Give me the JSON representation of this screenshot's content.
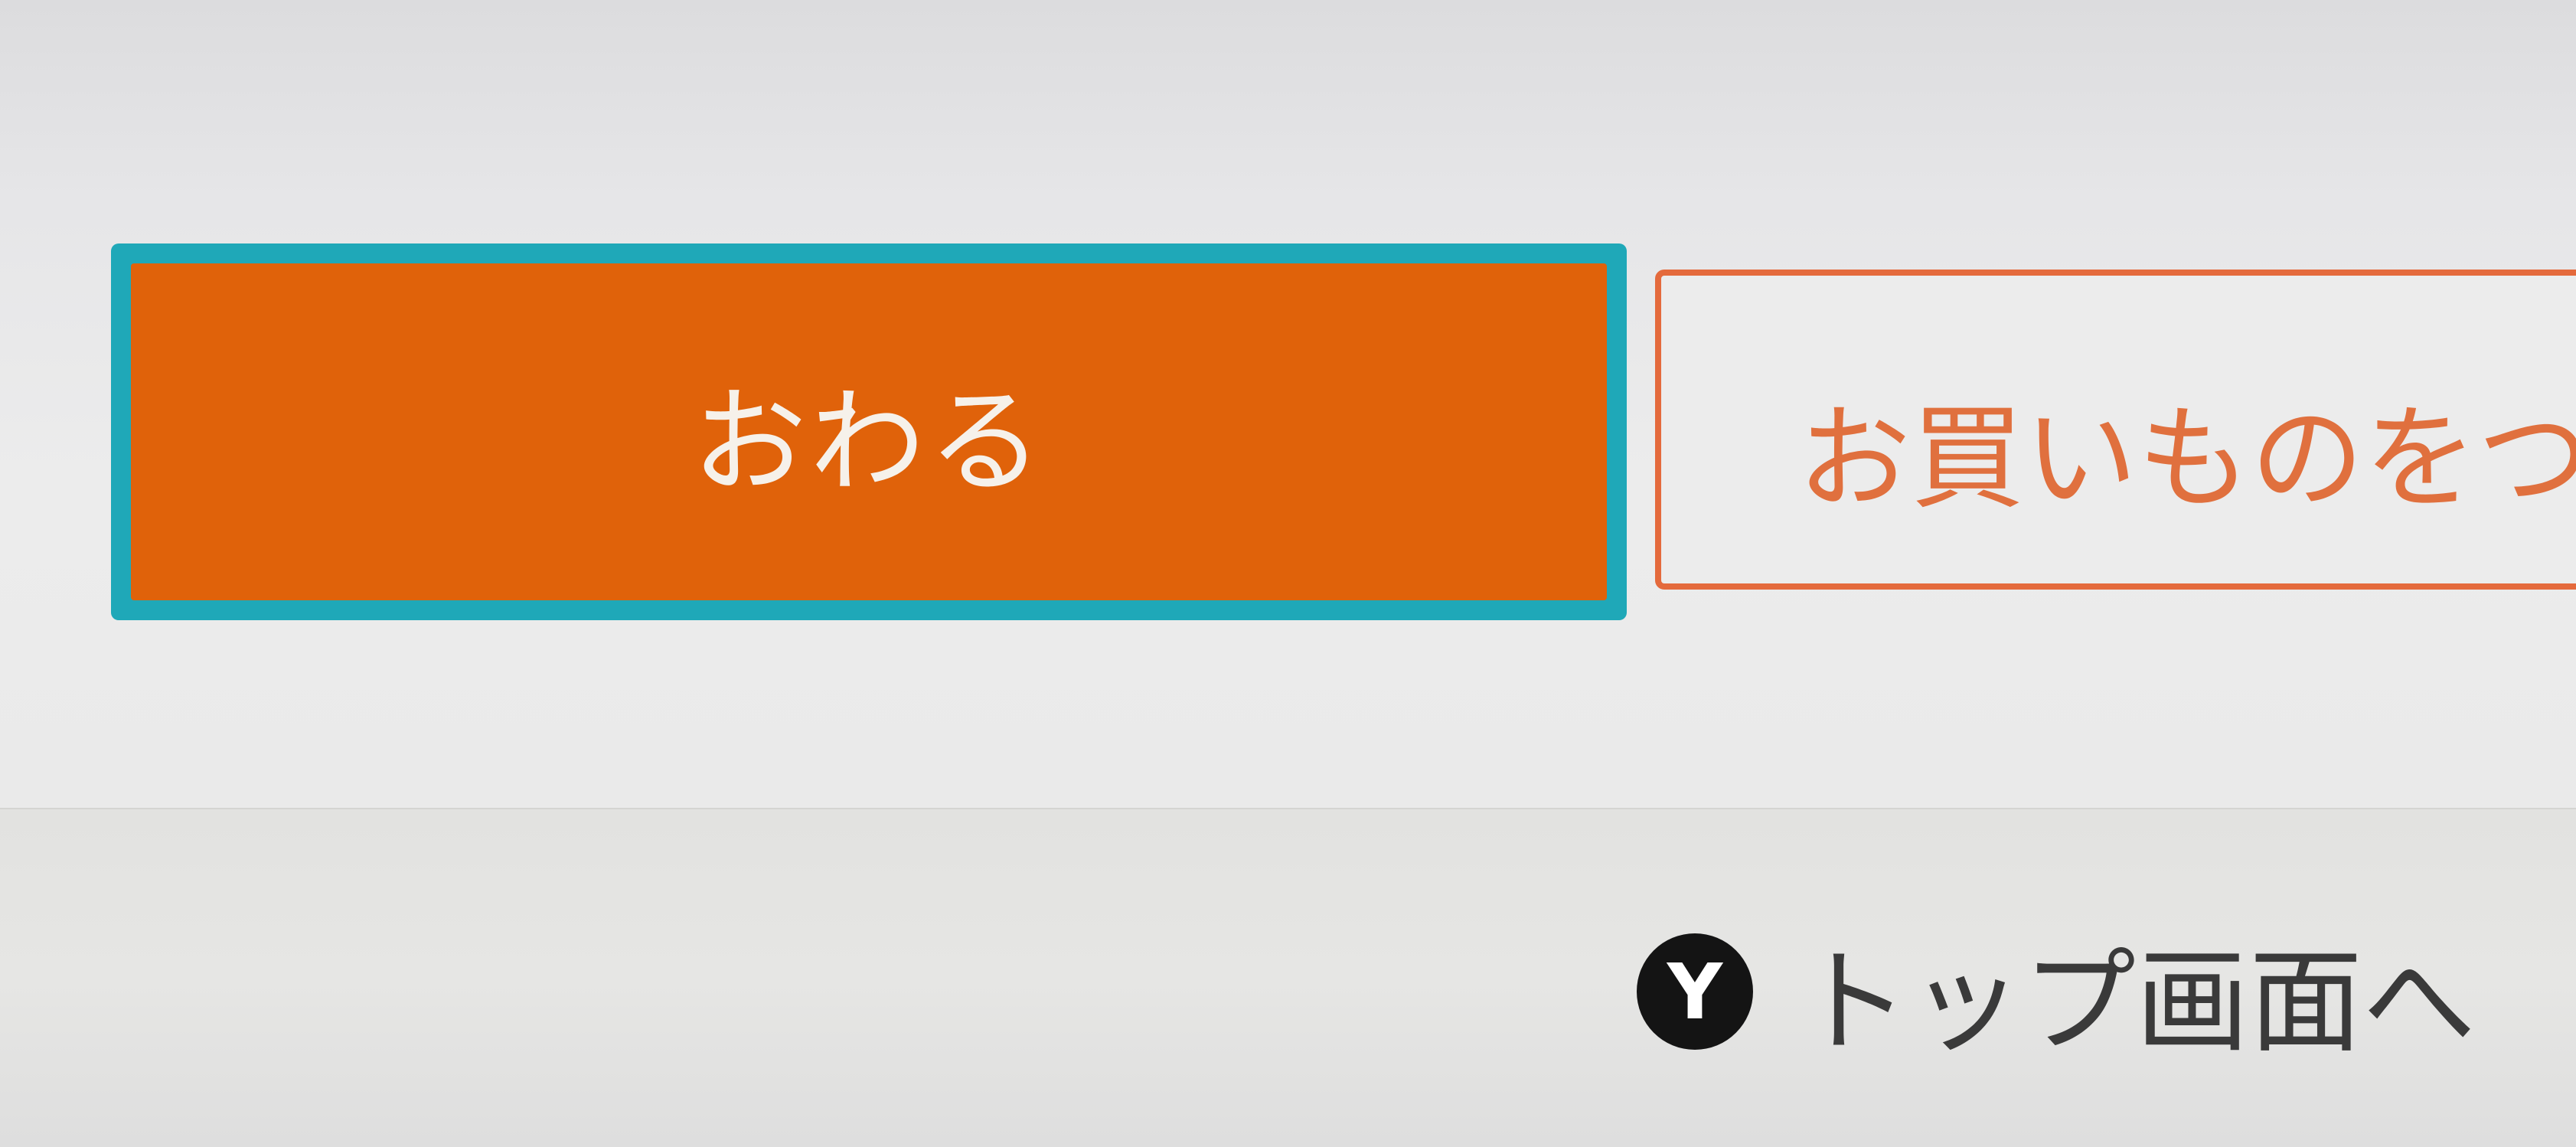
{
  "dialog": {
    "primary_button_label": "おわる",
    "secondary_button_label": "お買いものをつ"
  },
  "footer": {
    "top_link_icon": "Y",
    "top_link_label": "トップ画面へ"
  },
  "colors": {
    "primary_button": "#e0620a",
    "focus_ring": "#1fa8b8",
    "secondary_outline": "#e46a3c"
  },
  "icons": {
    "controller_y_button": "y-button-icon"
  }
}
